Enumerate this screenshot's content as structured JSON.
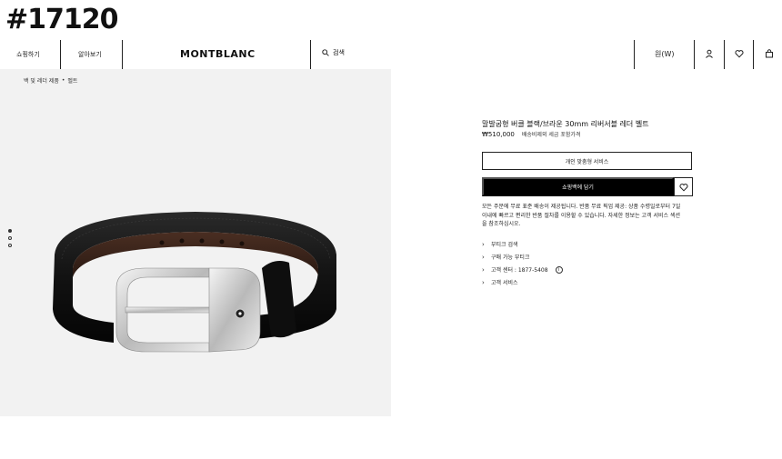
{
  "item_number": "#17120",
  "nav": {
    "shop_label": "쇼핑하기",
    "learn_label": "알아보기",
    "logo": "MONTBLANC",
    "search_label": "검색",
    "currency_label": "원(W)"
  },
  "breadcrumb": {
    "parent": "백 및 레더 제품",
    "current": "벨트"
  },
  "product": {
    "title": "말발굽형 버클 블랙/브라운 30mm 리버서블 레더 벨트",
    "price": "₩510,000",
    "tax_note": "배송비제외 세금 포함가격"
  },
  "actions": {
    "personalize_label": "개인 맞춤형 서비스",
    "add_to_cart_label": "쇼핑백에 담기"
  },
  "shipping_text": "모든 주문에 무료 표준 배송이 제공됩니다. 반품 무료 픽업 제공: 상품 수령일로부터 7일 이내에 빠르고 편리한 반품 절차를 이용할 수 있습니다. 자세한 정보는 고객 서비스 섹션을 참조하십시오.",
  "links": [
    {
      "label": "부티크 검색"
    },
    {
      "label": "구매 가능 부티크"
    },
    {
      "label": "고객 센터 : 1877-5408"
    },
    {
      "label": "고객 서비스"
    }
  ],
  "colors": {
    "gallery_bg": "#f2f2f2",
    "cart_button_bg": "#000000"
  },
  "gallery_dots": 3,
  "gallery_active_dot": 1
}
